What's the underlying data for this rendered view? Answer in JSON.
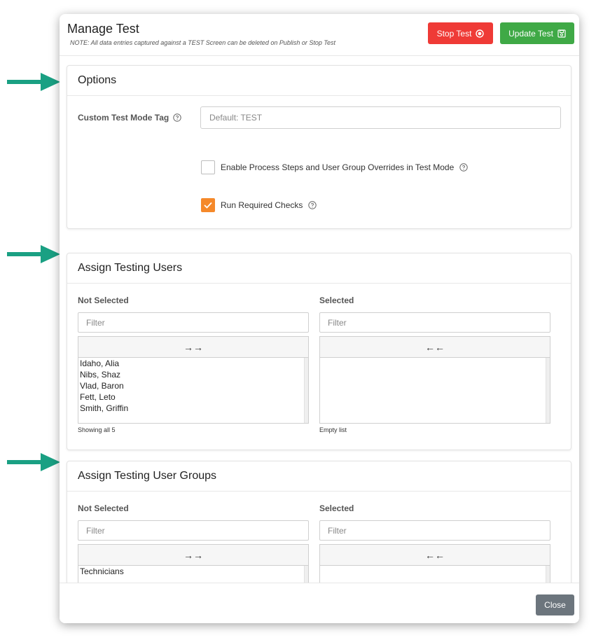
{
  "modal": {
    "title": "Manage Test",
    "note": "NOTE: All data entries captured against a TEST Screen can be deleted on Publish or Stop Test",
    "stop_label": "Stop Test",
    "update_label": "Update Test",
    "close_label": "Close"
  },
  "options": {
    "header": "Options",
    "tag_label": "Custom Test Mode Tag",
    "tag_placeholder": "Default: TEST",
    "override_label": "Enable Process Steps and User Group Overrides in Test Mode",
    "override_checked": false,
    "required_label": "Run Required Checks",
    "required_checked": true
  },
  "users": {
    "header": "Assign Testing Users",
    "not_selected_label": "Not Selected",
    "selected_label": "Selected",
    "filter_placeholder": "Filter",
    "move_all_right": "→→",
    "move_all_left": "←←",
    "not_selected_items": [
      "Idaho, Alia",
      "Nibs, Shaz",
      "Vlad, Baron",
      "Fett, Leto",
      "Smith, Griffin"
    ],
    "selected_items": [],
    "not_selected_status": "Showing all 5",
    "selected_status": "Empty list"
  },
  "groups": {
    "header": "Assign Testing User Groups",
    "not_selected_label": "Not Selected",
    "selected_label": "Selected",
    "filter_placeholder": "Filter",
    "move_all_right": "→→",
    "move_all_left": "←←",
    "not_selected_items": [
      "Technicians"
    ],
    "selected_items": []
  },
  "colors": {
    "stop": "#ef3a36",
    "update": "#3fa946",
    "check": "#f5892a",
    "arrow": "#1aa083",
    "close": "#6c757d"
  },
  "icons": {
    "stop": "stop-circle-icon",
    "update": "save-icon",
    "help": "question-circle-icon",
    "arrow": "annotation-arrow-icon"
  }
}
